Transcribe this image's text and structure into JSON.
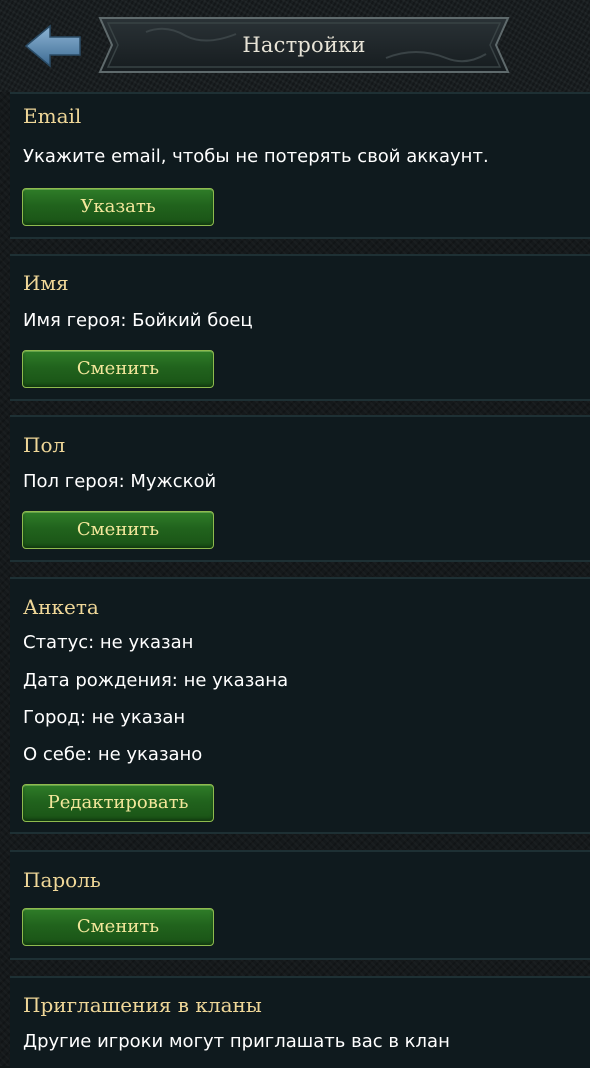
{
  "header": {
    "title": "Настройки",
    "back_icon": "arrow-left-icon"
  },
  "colors": {
    "section_title": "#efd798",
    "button_text": "#f3e79b",
    "button_green": "#2f7d28",
    "panel_bg": "#0f1a1e"
  },
  "sections": {
    "email": {
      "title": "Email",
      "text": "Укажите email, чтобы не потерять свой аккаунт.",
      "button": "Указать"
    },
    "name": {
      "title": "Имя",
      "text": "Имя героя: Бойкий боец",
      "button": "Сменить"
    },
    "gender": {
      "title": "Пол",
      "text": "Пол героя: Мужской",
      "button": "Сменить"
    },
    "profile": {
      "title": "Анкета",
      "lines": [
        "Статус: не указан",
        "Дата рождения: не указана",
        "Город: не указан",
        "О себе: не указано"
      ],
      "button": "Редактировать"
    },
    "password": {
      "title": "Пароль",
      "button": "Сменить"
    },
    "clan_invites": {
      "title": "Приглашения в кланы",
      "text": "Другие игроки могут приглашать вас в клан"
    }
  }
}
